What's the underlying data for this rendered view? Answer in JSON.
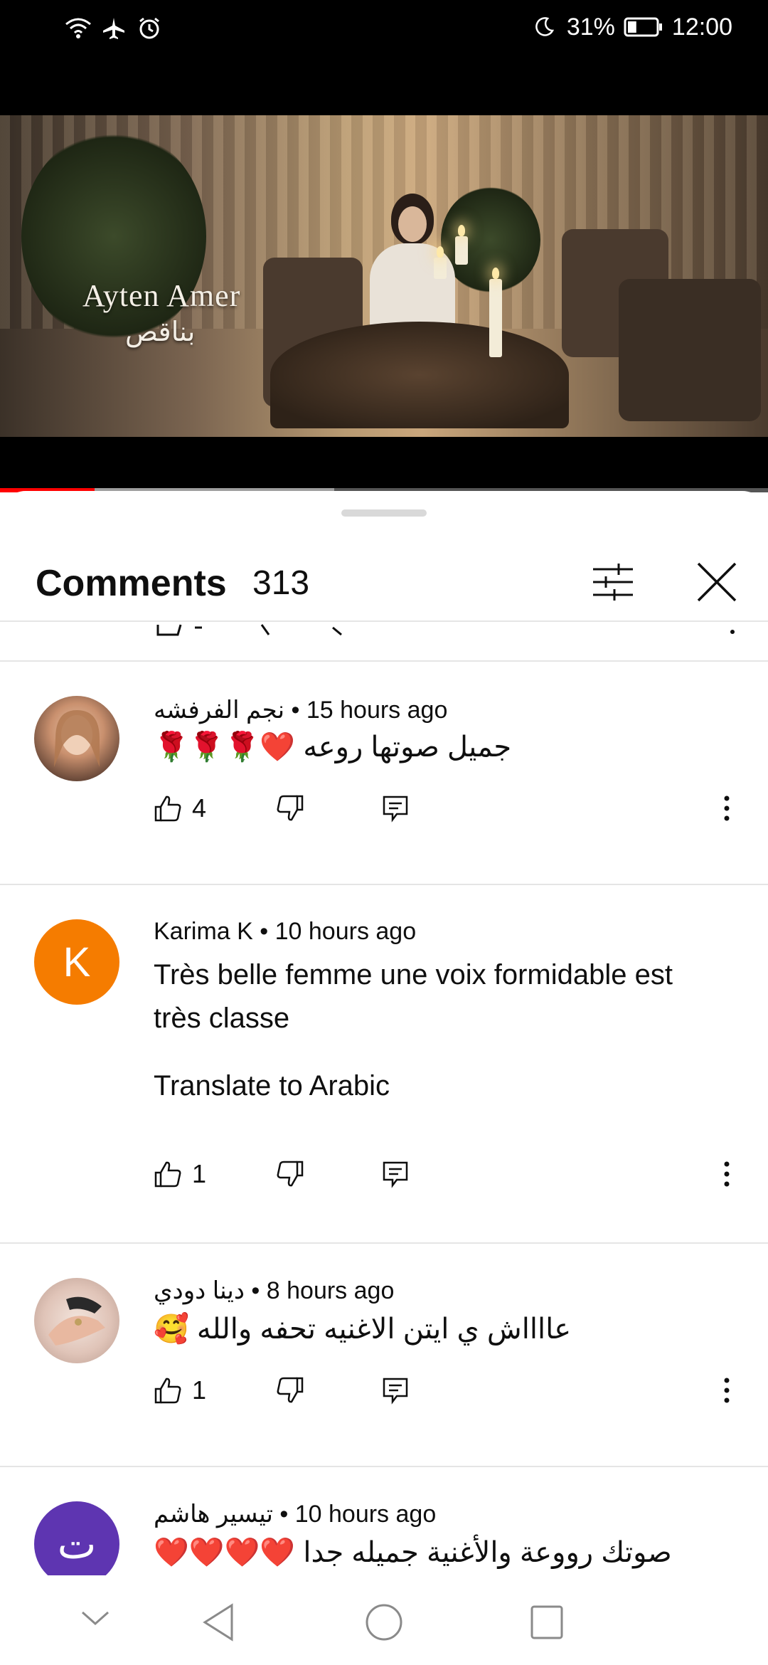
{
  "status_bar": {
    "icons_left": [
      "wifi-icon",
      "airplane-icon",
      "alarm-icon"
    ],
    "battery_percent": "31%",
    "battery_level": 0.31,
    "time": "12:00",
    "dnd": "moon-icon"
  },
  "video": {
    "overlay_artist": "Ayten Amer",
    "overlay_song": "بناقص",
    "progress_played": 0.123,
    "progress_buffered": 0.435
  },
  "comments_panel": {
    "title": "Comments",
    "count": "313",
    "comments": [
      {
        "author": "نجم الفرفشه",
        "time": "15 hours ago",
        "text": "جميل صوتها روعه ❤️🌹🌹🌹",
        "likes": "4",
        "avatar": "photo"
      },
      {
        "author": "Karima K",
        "time": "10 hours ago",
        "text": "Très belle femme une voix formidable est très classe",
        "translate": "Translate to Arabic",
        "likes": "1",
        "avatar_letter": "K",
        "avatar_color": "#f57c00"
      },
      {
        "author": "دينا دودي",
        "time": "8 hours ago",
        "text": "عااااش ي ايتن الاغنيه تحفه والله 🥰",
        "likes": "1",
        "avatar": "photo"
      },
      {
        "author": "تيسير هاشم",
        "time": "10 hours ago",
        "text": "صوتك رووعة والأغنية جميله جدا ❤️❤️❤️❤️",
        "avatar_letter": "ت",
        "avatar_color": "#5e35b1"
      }
    ]
  },
  "nav_bar": {
    "icons": [
      "chevron-down-icon",
      "back-icon",
      "home-icon",
      "recents-icon"
    ]
  },
  "colors": {
    "progress_played": "#ff0000",
    "accent_orange": "#f57c00",
    "accent_purple": "#5e35b1"
  }
}
